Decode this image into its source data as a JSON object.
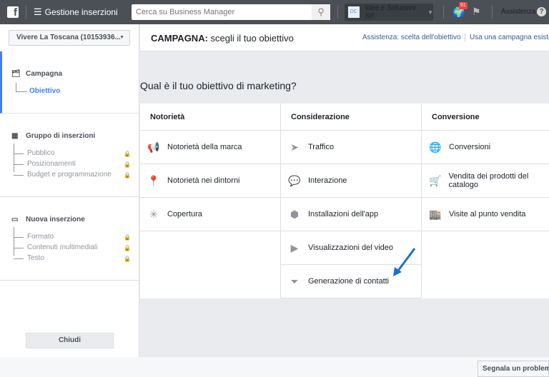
{
  "topbar": {
    "logo": "f",
    "menu_icon": "☰",
    "title": "Gestione inserzioni",
    "search_placeholder": "Cerca su Business Manager",
    "account_initials": "DC",
    "account_name": "Idee e Soluzioni Srl",
    "notifications": "91",
    "help": "Assistenza",
    "help_icon": "?"
  },
  "sidebar": {
    "account_select": "Vivere La Toscana (10153936...",
    "sections": [
      {
        "title": "Campagna",
        "items": [
          {
            "label": "Obiettivo"
          }
        ]
      },
      {
        "title": "Gruppo di inserzioni",
        "items": [
          {
            "label": "Pubblico"
          },
          {
            "label": "Posizionamenti"
          },
          {
            "label": "Budget e programmazione"
          }
        ]
      },
      {
        "title": "Nuova inserzione",
        "items": [
          {
            "label": "Formato"
          },
          {
            "label": "Contenuti multimediali"
          },
          {
            "label": "Testo"
          }
        ]
      }
    ],
    "close": "Chiudi"
  },
  "header": {
    "title_bold": "CAMPAGNA:",
    "title_rest": " scegli il tuo obiettivo",
    "link_help": "Assistenza: scelta dell'obiettivo",
    "link_existing": "Usa una campagna esistente"
  },
  "question": "Qual è il tuo obiettivo di marketing?",
  "columns": [
    {
      "title": "Notorietà",
      "items": [
        {
          "icon": "📢",
          "label": "Notorietà della marca"
        },
        {
          "icon": "📍",
          "label": "Notorietà nei dintorni"
        },
        {
          "icon": "✳",
          "label": "Copertura"
        }
      ]
    },
    {
      "title": "Considerazione",
      "items": [
        {
          "icon": "➤",
          "label": "Traffico"
        },
        {
          "icon": "💬",
          "label": "Interazione"
        },
        {
          "icon": "⬢",
          "label": "Installazioni dell'app"
        },
        {
          "icon": "▶",
          "label": "Visualizzazioni del video"
        },
        {
          "icon": "⏷",
          "label": "Generazione di contatti"
        }
      ]
    },
    {
      "title": "Conversione",
      "items": [
        {
          "icon": "🌐",
          "label": "Conversioni"
        },
        {
          "icon": "🛒",
          "label": "Vendita dei prodotti del catalogo"
        },
        {
          "icon": "🏬",
          "label": "Visite al punto vendita"
        }
      ]
    }
  ],
  "footer": {
    "report": "Segnala un problema"
  }
}
